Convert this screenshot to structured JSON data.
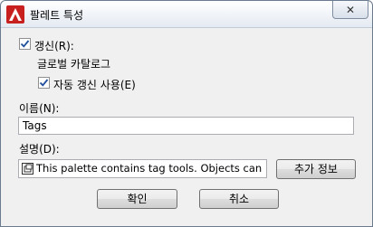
{
  "window": {
    "title": "팔레트 특성",
    "close_glyph": "✕"
  },
  "refresh": {
    "label": "갱신(R):",
    "checked": true,
    "source_name": "글로벌 카탈로그",
    "auto_refresh_label": "자동 갱신 사용(E)",
    "auto_refresh_checked": true
  },
  "name": {
    "label": "이름(N):",
    "value": "Tags"
  },
  "description": {
    "label": "설명(D):",
    "value": "This palette contains tag tools. Objects can ..."
  },
  "buttons": {
    "more_info": "추가 정보",
    "ok": "확인",
    "cancel": "취소"
  },
  "colors": {
    "app_icon_red": "#c8201e",
    "check_mark": "#1f4e9a"
  }
}
